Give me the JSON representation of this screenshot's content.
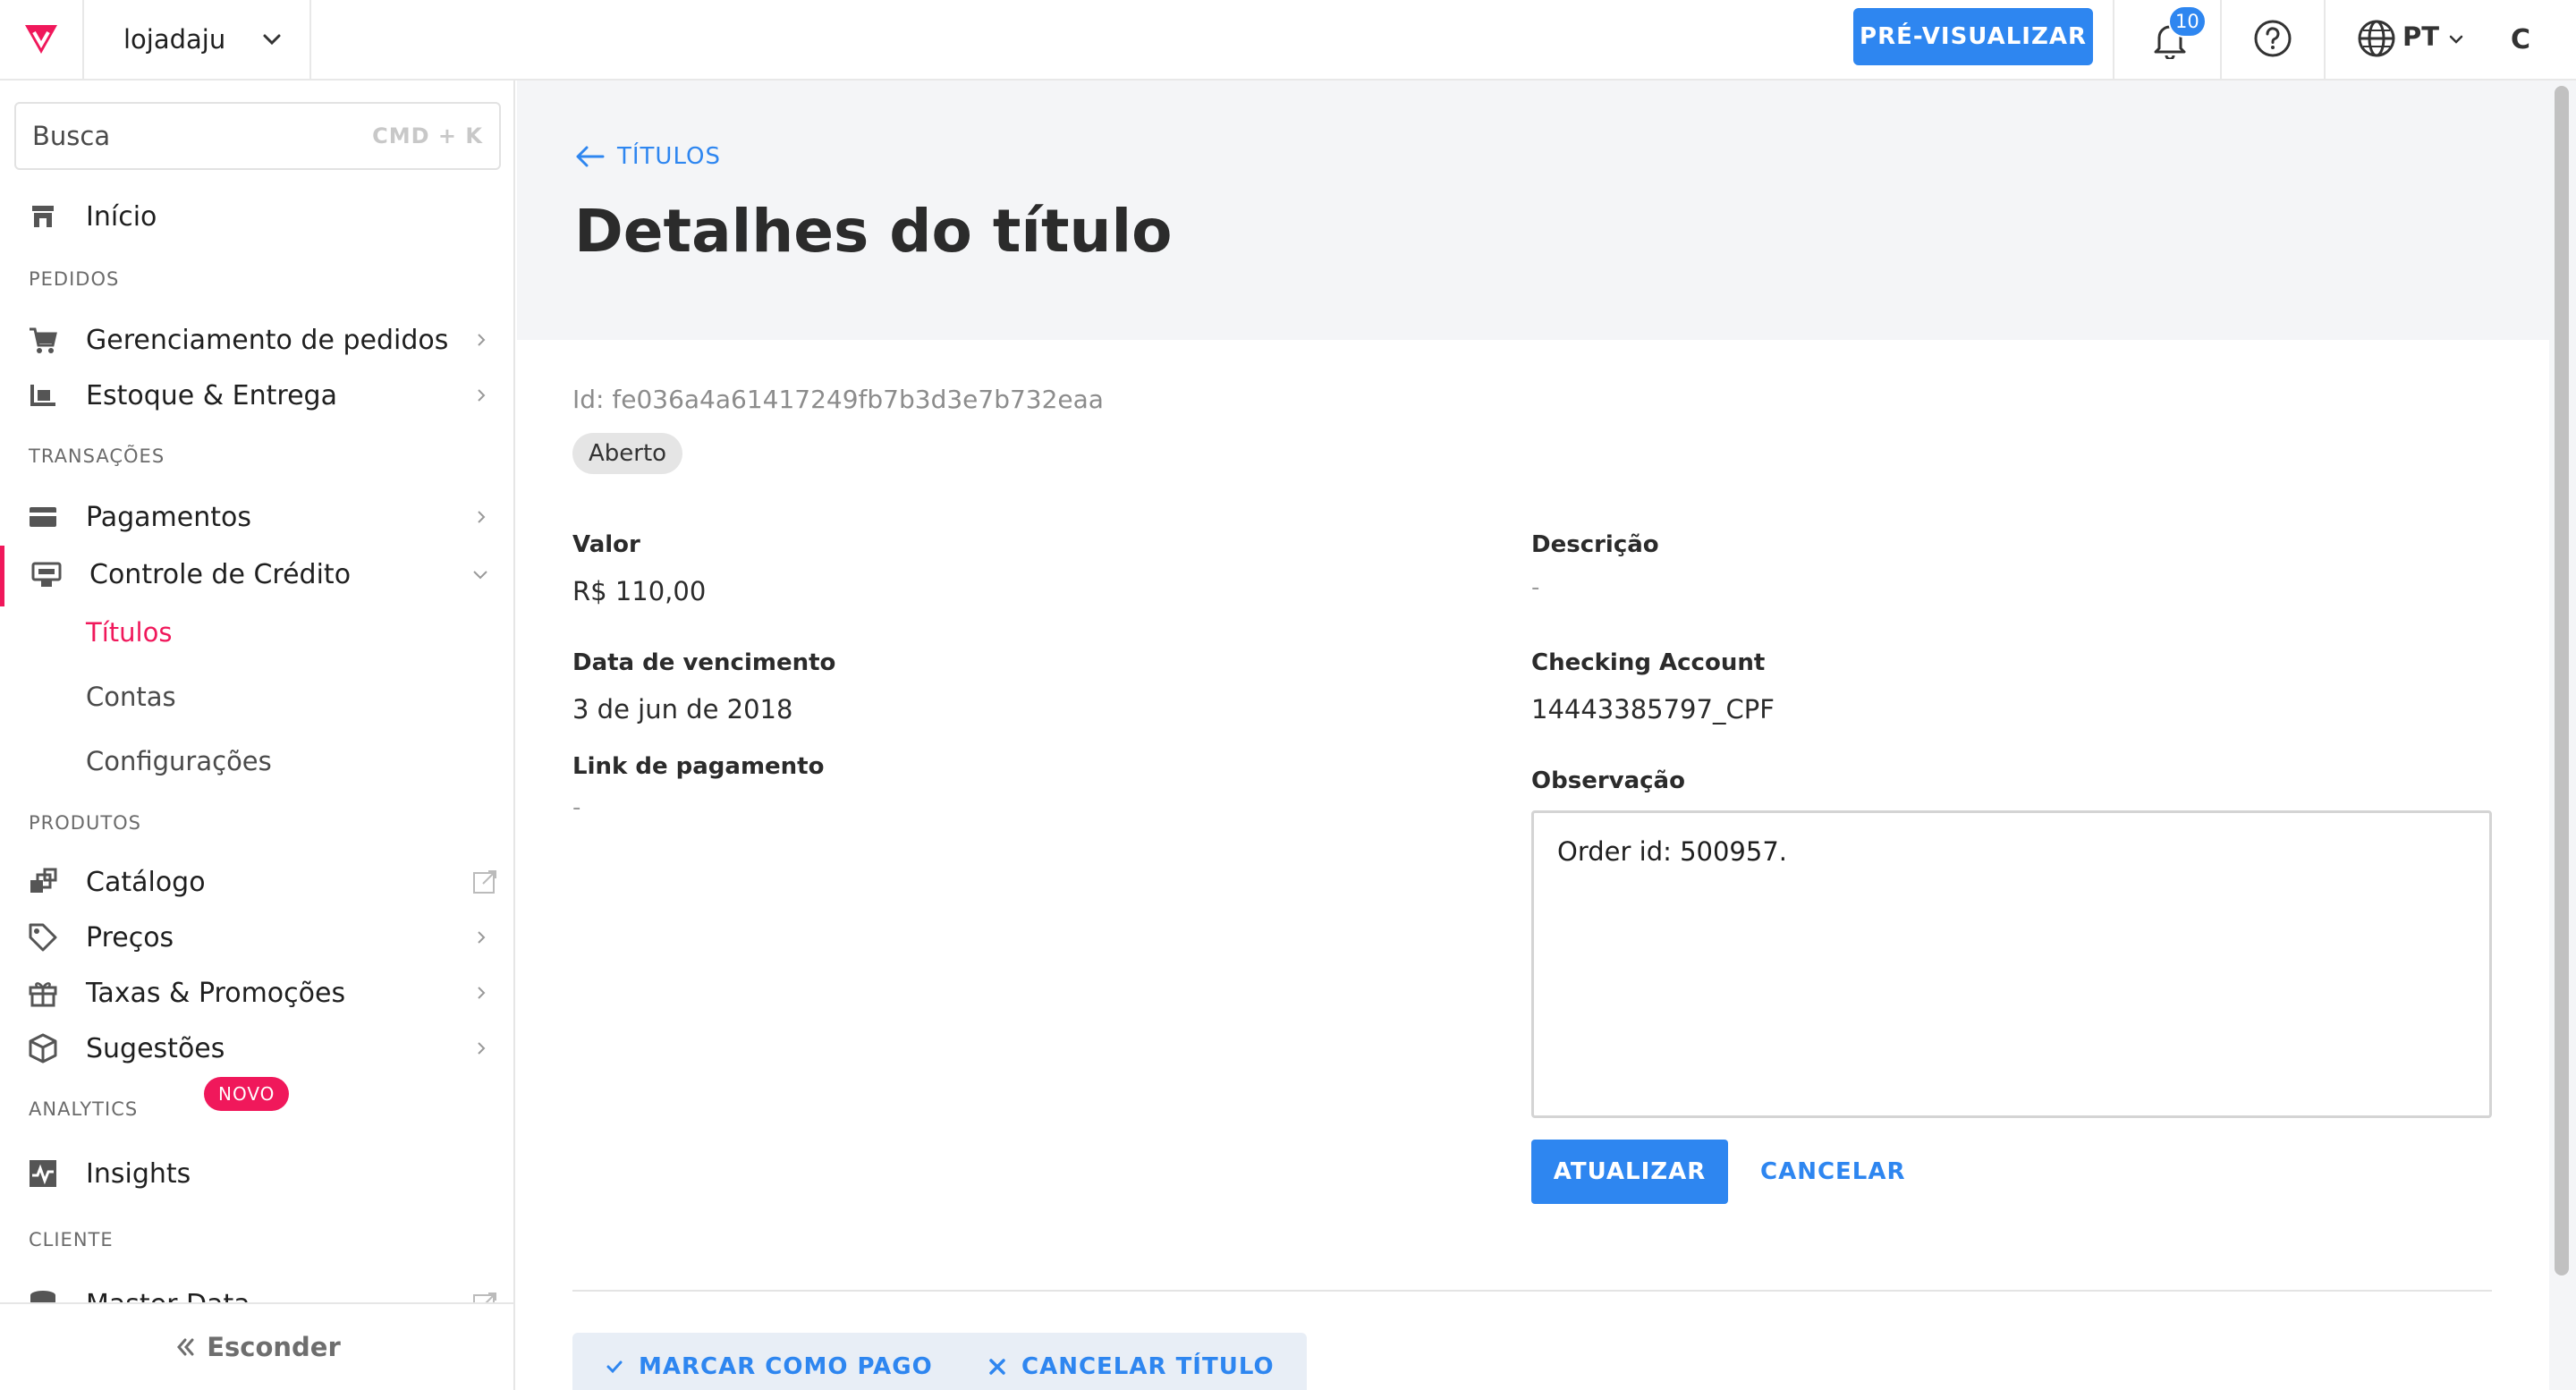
{
  "topbar": {
    "store_name": "lojadaju",
    "preview_label": "PRÉ-VISUALIZAR",
    "notification_count": "10",
    "language": "PT",
    "avatar_initial": "C"
  },
  "sidebar": {
    "search_placeholder": "Busca",
    "search_shortcut": "CMD + K",
    "home": "Início",
    "sections": {
      "pedidos": "PEDIDOS",
      "transacoes": "TRANSAÇÕES",
      "produtos": "PRODUTOS",
      "analytics": "ANALYTICS",
      "cliente": "CLIENTE"
    },
    "items": {
      "orders": "Gerenciamento de pedidos",
      "inventory": "Estoque & Entrega",
      "payments": "Pagamentos",
      "credit": "Controle de Crédito",
      "catalog": "Catálogo",
      "prices": "Preços",
      "promotions": "Taxas & Promoções",
      "suggestions": "Sugestões",
      "insights": "Insights",
      "masterdata": "Master Data"
    },
    "credit_sub": {
      "titles": "Títulos",
      "accounts": "Contas",
      "settings": "Configurações"
    },
    "new_badge": "NOVO",
    "hide_label": "Esconder"
  },
  "main": {
    "back_label": "TÍTULOS",
    "page_title": "Detalhes do título",
    "title_id": "Id: fe036a4a61417249fb7b3d3e7b732eaa",
    "status": "Aberto",
    "fields": {
      "valor_label": "Valor",
      "valor_value": "R$ 110,00",
      "vencimento_label": "Data de vencimento",
      "vencimento_value": "3 de jun de 2018",
      "link_label": "Link de pagamento",
      "link_value": "-",
      "descricao_label": "Descrição",
      "descricao_value": "-",
      "checking_label": "Checking Account",
      "checking_value": "14443385797_CPF",
      "obs_label": "Observação",
      "obs_value": "Order id: 500957."
    },
    "update_label": "ATUALIZAR",
    "cancel_label": "CANCELAR",
    "mark_paid_label": "MARCAR COMO PAGO",
    "cancel_title_label": "CANCELAR TÍTULO"
  },
  "colors": {
    "accent": "#2e86f0",
    "brand": "#f0185b"
  }
}
